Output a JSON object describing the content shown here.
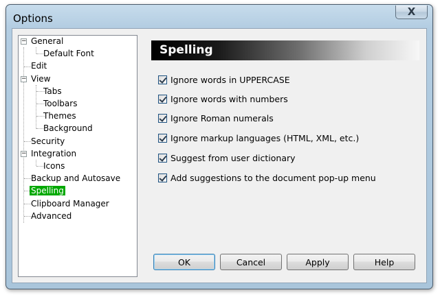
{
  "window": {
    "title": "Options",
    "close_label": "X"
  },
  "tree": {
    "items": [
      {
        "label": "General"
      },
      {
        "label": "Default Font"
      },
      {
        "label": "Edit"
      },
      {
        "label": "View"
      },
      {
        "label": "Tabs"
      },
      {
        "label": "Toolbars"
      },
      {
        "label": "Themes"
      },
      {
        "label": "Background"
      },
      {
        "label": "Security"
      },
      {
        "label": "Integration"
      },
      {
        "label": "Icons"
      },
      {
        "label": "Backup and Autosave"
      },
      {
        "label": "Spelling"
      },
      {
        "label": "Clipboard Manager"
      },
      {
        "label": "Advanced"
      }
    ],
    "selected": "Spelling"
  },
  "panel": {
    "header": "Spelling",
    "options": [
      {
        "label": "Ignore words in UPPERCASE",
        "checked": true
      },
      {
        "label": "Ignore words with numbers",
        "checked": true
      },
      {
        "label": "Ignore Roman numerals",
        "checked": true
      },
      {
        "label": "Ignore markup languages (HTML, XML, etc.)",
        "checked": true
      },
      {
        "label": "Suggest from user dictionary",
        "checked": true
      },
      {
        "label": "Add suggestions to the document pop-up menu",
        "checked": true
      }
    ]
  },
  "buttons": {
    "ok": "OK",
    "cancel": "Cancel",
    "apply": "Apply",
    "help": "Help"
  },
  "colors": {
    "selection": "#00a800",
    "header_start": "#000000",
    "header_end": "#f7f7f7"
  },
  "icons": {
    "close": "close-icon",
    "expander": "minus-icon",
    "checkbox": "checkmark-icon"
  }
}
